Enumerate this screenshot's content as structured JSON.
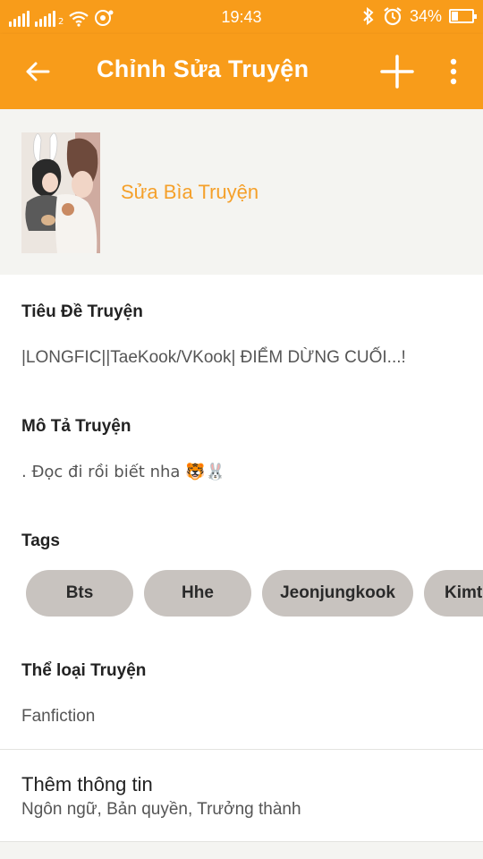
{
  "status_bar": {
    "time": "19:43",
    "battery_text": "34%",
    "battery_level": 0.34,
    "sim2_label": "2",
    "icons": [
      "signal-icon",
      "signal-icon",
      "wifi-icon",
      "notification-icon",
      "bluetooth-icon",
      "alarm-icon",
      "battery-icon"
    ]
  },
  "app_bar": {
    "title": "Chỉnh Sửa Truyện",
    "back_icon": "arrow-left-icon",
    "add_icon": "plus-icon",
    "more_icon": "more-vertical-icon"
  },
  "cover": {
    "edit_label": "Sửa Bìa Truyện"
  },
  "story": {
    "title_label": "Tiêu Đề Truyện",
    "title_value": "|LONGFIC||TaeKook/VKook| ĐIỂM DỪNG CUỐI...!",
    "description_label": "Mô Tả Truyện",
    "description_value": ". Đọc đi rồi biết nha 🐯🐰",
    "tags_label": "Tags",
    "tags": [
      "Bts",
      "Hhe",
      "Jeonjungkook",
      "Kimt"
    ],
    "category_label": "Thể loại Truyện",
    "category_value": "Fanfiction"
  },
  "more_info": {
    "title": "Thêm thông tin",
    "subtitle": "Ngôn ngữ, Bản quyền, Trưởng thành"
  },
  "colors": {
    "accent": "#f89c1a",
    "link": "#f5a02a",
    "tag_bg": "#c8c3bf"
  }
}
